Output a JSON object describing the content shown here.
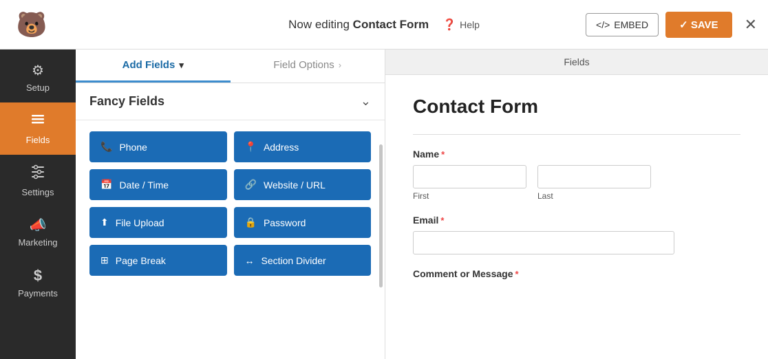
{
  "topbar": {
    "editing_prefix": "Now editing ",
    "form_name": "Contact Form",
    "help_label": "Help",
    "embed_label": "EMBED",
    "save_label": "✓ SAVE",
    "close_label": "✕"
  },
  "sidenav": {
    "items": [
      {
        "id": "setup",
        "label": "Setup",
        "icon": "⚙"
      },
      {
        "id": "fields",
        "label": "Fields",
        "icon": "☰",
        "active": true
      },
      {
        "id": "settings",
        "label": "Settings",
        "icon": "⊟"
      },
      {
        "id": "marketing",
        "label": "Marketing",
        "icon": "📣"
      },
      {
        "id": "payments",
        "label": "Payments",
        "icon": "$"
      }
    ]
  },
  "panel": {
    "tabs": [
      {
        "id": "add-fields",
        "label": "Add Fields",
        "active": true
      },
      {
        "id": "field-options",
        "label": "Field Options",
        "active": false
      }
    ],
    "fancy_fields_label": "Fancy Fields",
    "buttons": [
      {
        "id": "phone",
        "label": "Phone",
        "icon": "📞"
      },
      {
        "id": "address",
        "label": "Address",
        "icon": "📍"
      },
      {
        "id": "date-time",
        "label": "Date / Time",
        "icon": "📅"
      },
      {
        "id": "website-url",
        "label": "Website / URL",
        "icon": "🔗"
      },
      {
        "id": "file-upload",
        "label": "File Upload",
        "icon": "⬆"
      },
      {
        "id": "password",
        "label": "Password",
        "icon": "🔒"
      },
      {
        "id": "page-break",
        "label": "Page Break",
        "icon": "⊞"
      },
      {
        "id": "section-divider",
        "label": "Section Divider",
        "icon": "↔"
      }
    ]
  },
  "preview": {
    "fields_tab_label": "Fields",
    "form_title": "Contact Form",
    "name_label": "Name",
    "first_label": "First",
    "last_label": "Last",
    "email_label": "Email",
    "comment_label": "Comment or Message"
  }
}
